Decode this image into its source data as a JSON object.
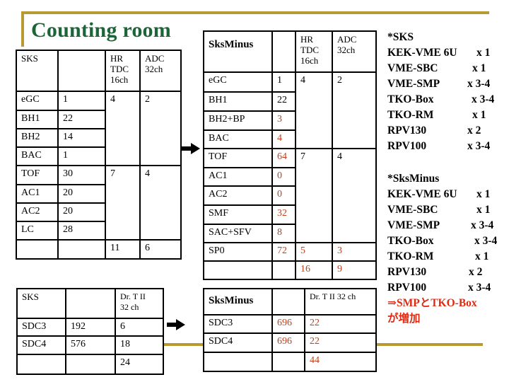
{
  "title": "Counting room",
  "sks_table": {
    "headers": [
      "SKS",
      "",
      "HR TDC 16ch",
      "ADC 32ch"
    ],
    "header_lines": {
      "hrtdc": [
        "HR",
        "TDC",
        "16ch"
      ],
      "adc": [
        "ADC",
        "32ch"
      ]
    },
    "rows": [
      {
        "name": "eGC",
        "ch": "1"
      },
      {
        "name": "BH1",
        "ch": "22"
      },
      {
        "name": "BH2",
        "ch": "14"
      },
      {
        "name": "BAC",
        "ch": "1"
      },
      {
        "name": "TOF",
        "ch": "30"
      },
      {
        "name": "AC1",
        "ch": "20"
      },
      {
        "name": "AC2",
        "ch": "20"
      },
      {
        "name": "LC",
        "ch": "28"
      }
    ],
    "groups": [
      {
        "hrtdc": "4",
        "adc": "2"
      },
      {
        "hrtdc": "7",
        "adc": "4"
      }
    ],
    "totals": {
      "hrtdc": "11",
      "adc": "6"
    }
  },
  "sksminus_table": {
    "title": "SksMinus",
    "header_lines": {
      "hrtdc": [
        "HR",
        "TDC",
        "16ch"
      ],
      "adc": [
        "ADC",
        "32ch"
      ]
    },
    "rows": [
      {
        "name": "eGC",
        "ch": "1",
        "changed": false
      },
      {
        "name": "BH1",
        "ch": "22",
        "changed": false
      },
      {
        "name": "BH2+BP",
        "ch": "3",
        "changed": true
      },
      {
        "name": "BAC",
        "ch": "4",
        "changed": true
      },
      {
        "name": "TOF",
        "ch": "64",
        "changed": true
      },
      {
        "name": "AC1",
        "ch": "0",
        "changed": true
      },
      {
        "name": "AC2",
        "ch": "0",
        "changed": true
      },
      {
        "name": "SMF",
        "ch": "32",
        "changed": true
      },
      {
        "name": "SAC+SFV",
        "ch": "8",
        "changed": true
      },
      {
        "name": "SP0",
        "ch": "72",
        "changed": true
      }
    ],
    "groups": [
      {
        "hrtdc": "4",
        "adc": "2"
      },
      {
        "hrtdc": "7",
        "adc": "4"
      },
      {
        "hrtdc": "5",
        "adc": "3"
      }
    ],
    "totals": {
      "hrtdc": "16",
      "adc": "9"
    }
  },
  "sks_drift_table": {
    "title": "SKS",
    "header_lines": [
      "Dr. T II",
      "32 ch"
    ],
    "rows": [
      {
        "name": "SDC3",
        "ch": "192",
        "drt": "6"
      },
      {
        "name": "SDC4",
        "ch": "576",
        "drt": "18"
      }
    ],
    "total": "24"
  },
  "sksminus_drift_table": {
    "title": "SksMinus",
    "header": "Dr. T II 32 ch",
    "rows": [
      {
        "name": "SDC3",
        "ch": "696",
        "drt": "22"
      },
      {
        "name": "SDC4",
        "ch": "696",
        "drt": "22"
      }
    ],
    "total": "44"
  },
  "sks_modules": {
    "heading": "*SKS",
    "items": [
      {
        "label": "KEK-VME 6U",
        "qty": "x 1"
      },
      {
        "label": "VME-SBC",
        "qty": "x 1"
      },
      {
        "label": "VME-SMP",
        "qty": "x 3-4"
      },
      {
        "label": "TKO-Box",
        "qty": "x 3-4"
      },
      {
        "label": "TKO-RM",
        "qty": "x 1"
      },
      {
        "label": "RPV130",
        "qty": "x 2"
      },
      {
        "label": "RPV100",
        "qty": "x 3-4"
      }
    ]
  },
  "sksminus_modules": {
    "heading": "*SksMinus",
    "items": [
      {
        "label": "KEK-VME 6U",
        "qty": "x 1"
      },
      {
        "label": "VME-SBC",
        "qty": "x 1"
      },
      {
        "label": "VME-SMP",
        "qty": "x 3-4"
      },
      {
        "label": "TKO-Box",
        "qty": "x 3-4"
      },
      {
        "label": "TKO-RM",
        "qty": "x 1"
      },
      {
        "label": "RPV130",
        "qty": "x 2"
      },
      {
        "label": "RPV100",
        "qty": "x 3-4"
      }
    ],
    "note_line1": "⇒SMPとTKO-Box",
    "note_line2": "が増加"
  },
  "colors": {
    "title": "#1d6538",
    "accent_line": "#b89a33",
    "changed_value": "#c0401a",
    "note": "#e02a10"
  }
}
